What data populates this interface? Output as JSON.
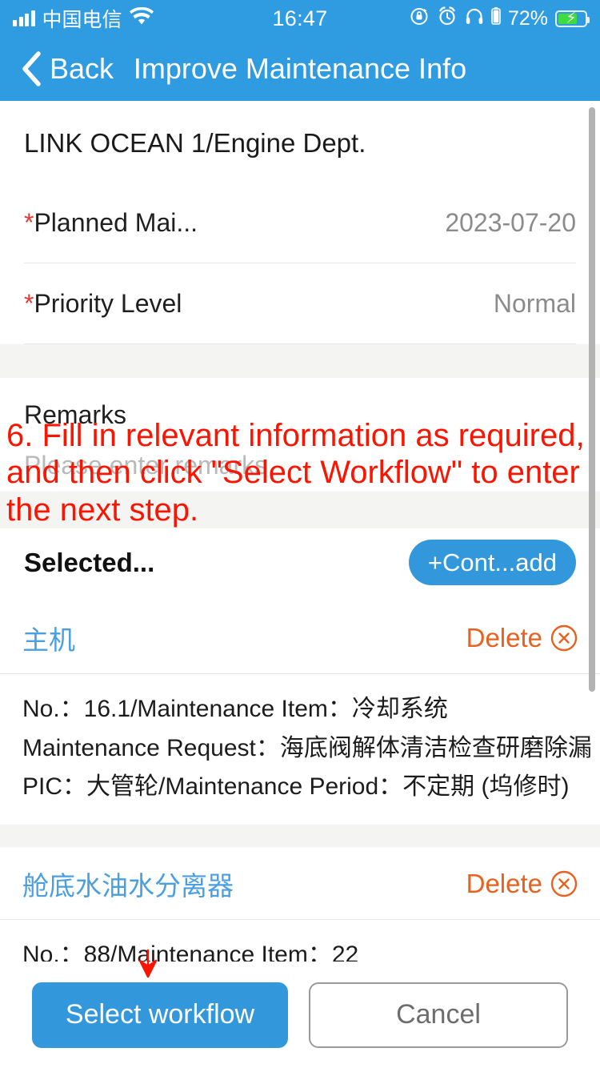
{
  "colors": {
    "brand_blue": "#2f9be0",
    "button_blue": "#3398db",
    "link_blue": "#4a9fe0",
    "delete_orange": "#e8611f",
    "annotation_red": "#fb1400",
    "required_red": "#e53935",
    "battery_green": "#3fdb3f",
    "band_gray": "#f4f4f3"
  },
  "status_bar": {
    "signal_icon": "signal-bars-icon",
    "carrier": "中国电信",
    "wifi_icon": "wifi-icon",
    "time": "16:47",
    "rotation_lock_icon": "rotation-lock-icon",
    "alarm_icon": "alarm-clock-icon",
    "headphones_icon": "headphones-icon",
    "battery_percent": "72%",
    "battery_icon": "battery-charging-icon"
  },
  "navbar": {
    "back_icon": "chevron-left-icon",
    "back_label": "Back",
    "title": "Improve Maintenance Info"
  },
  "form": {
    "vessel_dept": "LINK OCEAN 1/Engine Dept.",
    "fields": [
      {
        "required_mark": "*",
        "label": "Planned Mai...",
        "value": "2023-07-20"
      },
      {
        "required_mark": "*",
        "label": "Priority Level",
        "value": "Normal"
      }
    ],
    "remarks": {
      "label": "Remarks",
      "placeholder": "Please enter remarks",
      "value": ""
    }
  },
  "selected_section": {
    "label": "Selected...",
    "add_button": "+Cont...add",
    "items": [
      {
        "equipment": "主机",
        "delete_label": "Delete",
        "delete_icon": "circle-x-icon",
        "lines": [
          "No.：16.1/Maintenance Item：冷却系统",
          "Maintenance Request：海底阀解体清洁检查研磨除漏",
          "PIC：大管轮/Maintenance Period：不定期 (坞修时)"
        ]
      },
      {
        "equipment": "舱底水油水分离器",
        "delete_label": "Delete",
        "delete_icon": "circle-x-icon",
        "lines": [
          "No.：88/Maintenance Item：22"
        ]
      }
    ]
  },
  "annotation": {
    "text": "6. Fill in relevant information as required, and then click \"Select Workflow\" to enter the next step.",
    "arrow_icon": "down-arrow-icon"
  },
  "bottom_bar": {
    "primary_button": "Select workflow",
    "secondary_button": "Cancel"
  },
  "scrollbar": {
    "name": "vertical-scrollbar"
  }
}
